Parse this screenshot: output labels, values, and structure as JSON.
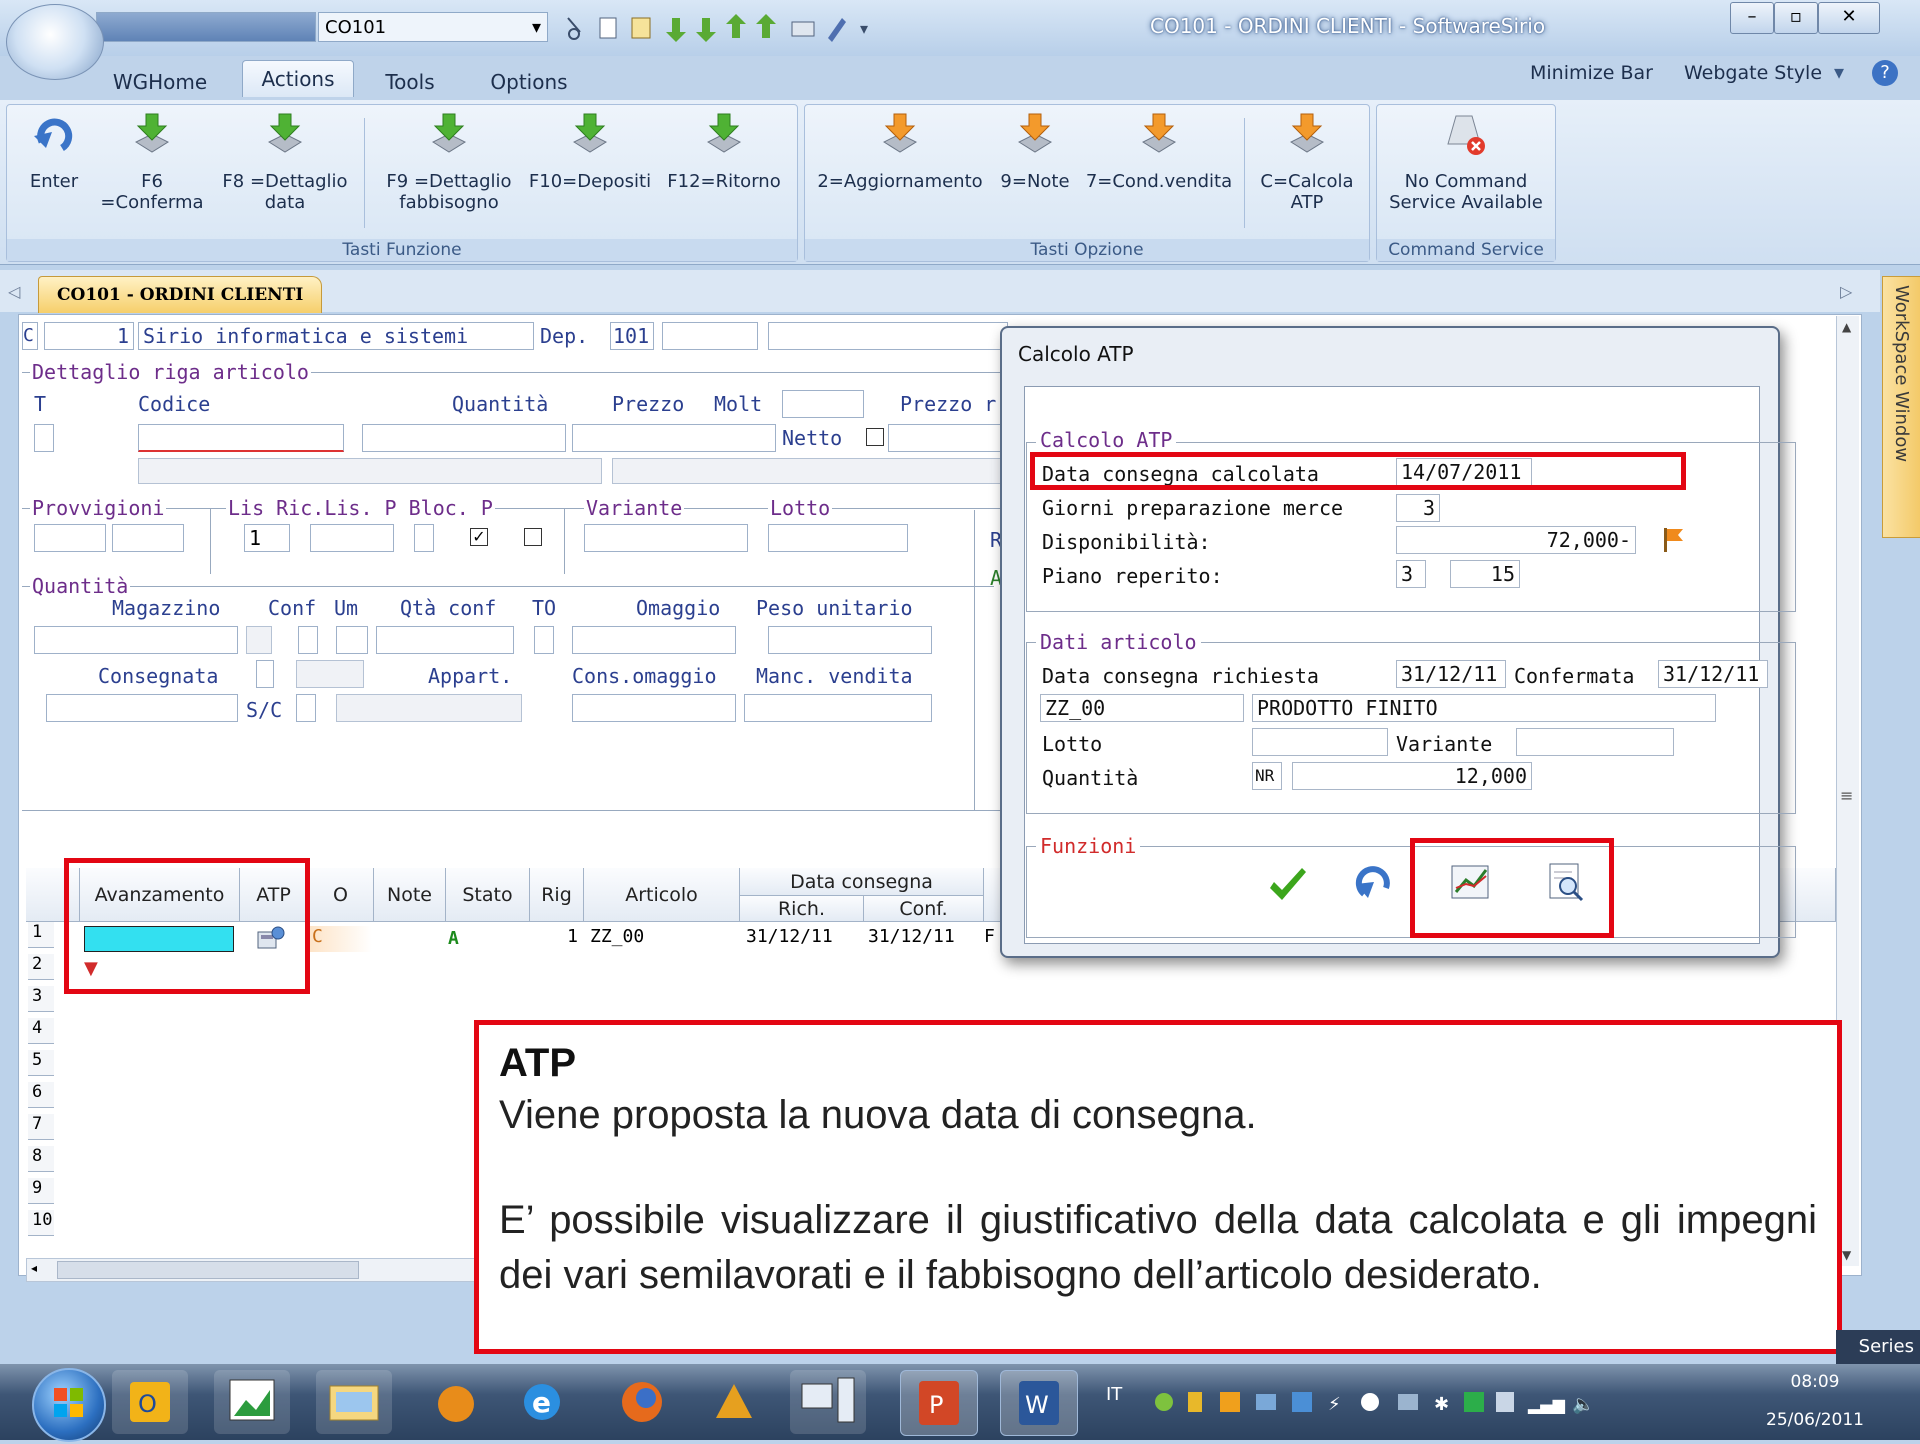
{
  "titlebar": {
    "combo1": "CO101",
    "title": "CO101 - ORDINI CLIENTI - SoftwareSirio",
    "minimize": "–",
    "maximize": "▫",
    "close": "✕"
  },
  "ribbon": {
    "tabs": [
      "WGHome",
      "Actions",
      "Tools",
      "Options"
    ],
    "active_tab": "Actions",
    "right_links": [
      "Minimize Bar",
      "Webgate Style"
    ],
    "groups": [
      {
        "title": "Tasti Funzione",
        "buttons": [
          {
            "line1": "Enter",
            "line2": "",
            "icon": "enter-arrow-icon"
          },
          {
            "line1": "F6",
            "line2": "=Conferma",
            "icon": "green-arrow-icon"
          },
          {
            "line1": "F8 =Dettaglio",
            "line2": "data",
            "icon": "green-arrow-icon"
          },
          {
            "line1": "F9 =Dettaglio",
            "line2": "fabbisogno",
            "icon": "green-arrow-icon"
          },
          {
            "line1": "F10=Depositi",
            "line2": "",
            "icon": "green-arrow-icon"
          },
          {
            "line1": "F12=Ritorno",
            "line2": "",
            "icon": "green-arrow-icon"
          }
        ]
      },
      {
        "title": "Tasti Opzione",
        "buttons": [
          {
            "line1": "2=Aggiornamento",
            "line2": "",
            "icon": "orange-arrow-icon"
          },
          {
            "line1": "9=Note",
            "line2": "",
            "icon": "orange-arrow-icon"
          },
          {
            "line1": "7=Cond.vendita",
            "line2": "",
            "icon": "orange-arrow-icon"
          },
          {
            "line1": "C=Calcola",
            "line2": "ATP",
            "icon": "orange-arrow-icon"
          }
        ]
      },
      {
        "title": "Command Service",
        "buttons": [
          {
            "line1": "No Command",
            "line2": "Service Available",
            "icon": "no-service-icon"
          }
        ]
      }
    ]
  },
  "doc_tab": "CO101 - ORDINI CLIENTI",
  "side_tab": "WorkSpace Window",
  "form": {
    "header": {
      "c": "C",
      "num": "1",
      "company": "Sirio informatica e sistemi",
      "dep_label": "Dep.",
      "dep_value": "101"
    },
    "dettaglio_title": "Dettaglio riga articolo",
    "labels_row1": {
      "t": "T",
      "codice": "Codice",
      "quantita": "Quantità",
      "prezzo": "Prezzo",
      "molt": "Molt",
      "prezzo2": "Prezzo r",
      "netto": "Netto"
    },
    "provvigioni": "Provvigioni",
    "lis": "Lis Ric.Lis. P Bloc. P",
    "lis_value": "1",
    "variante": "Variante",
    "lotto": "Lotto",
    "quantita_sect": "Quantità",
    "labels_q1": {
      "magazzino": "Magazzino",
      "conf": "Conf",
      "um": "Um",
      "qta_conf": "Qtà conf",
      "to": "TO",
      "omaggio": "Omaggio",
      "peso": "Peso unitario"
    },
    "labels_q2": {
      "consegnata": "Consegnata",
      "appart": "Appart.",
      "cons_omaggio": "Cons.omaggio",
      "manc": "Manc. vendita",
      "sc": "S/C"
    },
    "side_letters": [
      "R",
      "A"
    ]
  },
  "grid": {
    "headers": [
      "Avanzamento",
      "ATP",
      "O",
      "Note",
      "Stato",
      "Rig",
      "Articolo"
    ],
    "data_consegna": "Data consegna",
    "rich": "Rich.",
    "conf": "Conf.",
    "row1": {
      "o": "C",
      "stato": "A",
      "rig": "1",
      "articolo": "ZZ_00",
      "rich": "31/12/11",
      "conf": "31/12/11",
      "tail": "F"
    },
    "row_numbers": [
      "1",
      "2",
      "3",
      "4",
      "5",
      "6",
      "7",
      "8",
      "9",
      "10"
    ]
  },
  "dialog": {
    "title": "Calcolo ATP",
    "sect_calc": "Calcolo ATP",
    "data_consegna_calcolata_label": "Data consegna calcolata",
    "data_consegna_calcolata": "14/07/2011",
    "giorni_label": "Giorni preparazione merce",
    "giorni": "3",
    "disponibilita_label": "Disponibilità:",
    "disponibilita": "72,000-",
    "piano_label": "Piano reperito:",
    "piano_a": "3",
    "piano_b": "15",
    "sect_dati": "Dati articolo",
    "data_rich_label": "Data consegna richiesta",
    "data_rich": "31/12/11",
    "confermata_label": "Confermata",
    "confermata": "31/12/11",
    "articolo": "ZZ_00",
    "descrizione": "PRODOTTO FINITO",
    "lotto_label": "Lotto",
    "variante_label": "Variante",
    "quantita_label": "Quantità",
    "um": "NR",
    "quantita": "12,000",
    "sect_funzioni": "Funzioni"
  },
  "callout": {
    "title": "ATP",
    "line1": "Viene proposta la nuova data di consegna.",
    "para2": "E’ possibile visualizzare il giustificativo della data calcolata e gli  impegni dei vari semilavorati e il  fabbisogno dell’articolo desiderato."
  },
  "taskbar": {
    "lang": "IT",
    "time": "08:09",
    "date": "25/06/2011",
    "series": "Series"
  },
  "colors": {
    "highlight_red": "#e30613",
    "cyan_cell": "#33e0f0",
    "accent_orange": "#f6cf6b"
  }
}
